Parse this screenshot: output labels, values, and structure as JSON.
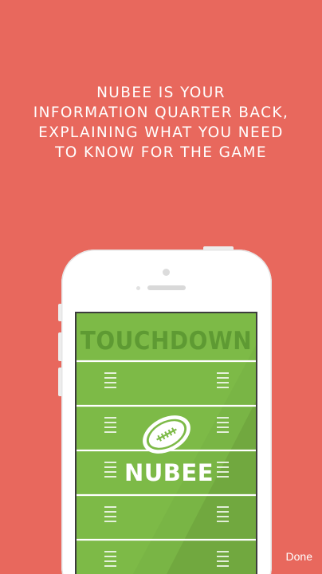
{
  "headline": {
    "lines": [
      "NUBEE IS YOUR",
      "INFORMATION QUARTER BACK,",
      "EXPLAINING WHAT YOU NEED",
      "TO KNOW FOR THE GAME"
    ]
  },
  "phone_screen": {
    "endzone_text": "TOUCHDOWN",
    "logo_text": "NUBEE",
    "field_color": "#7DBA47",
    "shadow_color": "#6FA43E",
    "endzone_text_color": "#5E9A33"
  },
  "footer": {
    "done_label": "Done"
  },
  "colors": {
    "background": "#E8685D",
    "text": "#FFFFFF",
    "phone_body": "#FFFFFF"
  }
}
